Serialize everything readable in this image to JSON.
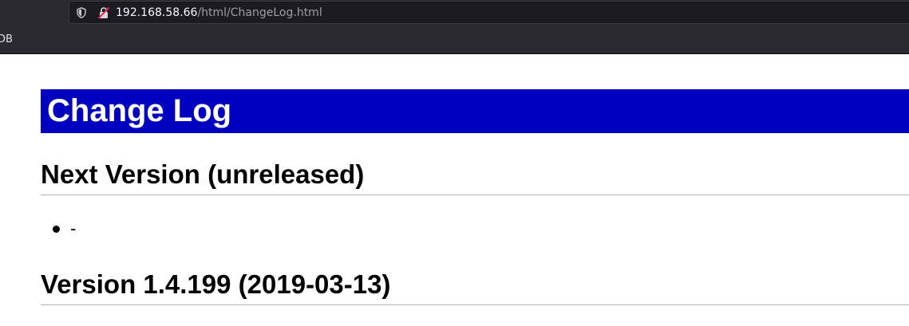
{
  "browser": {
    "url_host": "192.168.58.66",
    "url_path": "/html/ChangeLog.html",
    "bookmark_fragment": "DB"
  },
  "page": {
    "title": "Change Log",
    "sections": [
      {
        "heading": "Next Version (unreleased)",
        "items": [
          "-"
        ]
      },
      {
        "heading": "Version 1.4.199 (2019-03-13)"
      }
    ]
  }
}
